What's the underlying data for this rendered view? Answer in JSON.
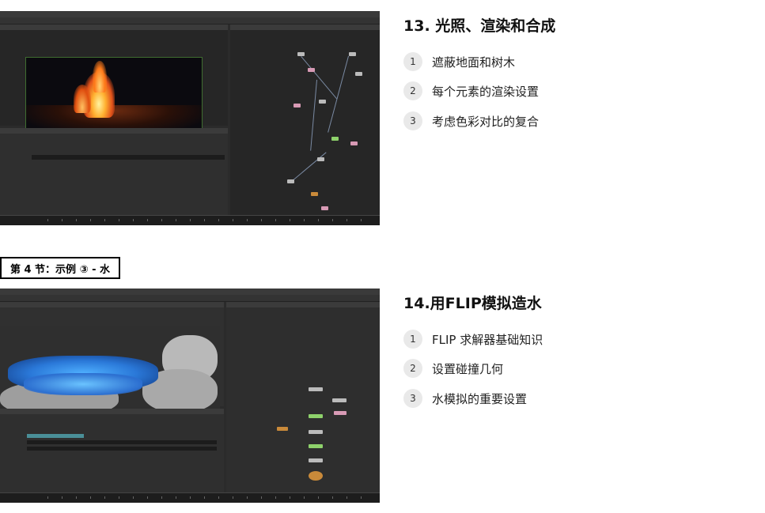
{
  "sections": [
    {
      "title": "13. 光照、渲染和合成",
      "items": [
        {
          "num": "1",
          "label": "遮蔽地面和树木"
        },
        {
          "num": "2",
          "label": "每个元素的渲染设置"
        },
        {
          "num": "3",
          "label": "考虑色彩对比的复合"
        }
      ]
    },
    {
      "title": "14.用FLIP模拟造水",
      "items": [
        {
          "num": "1",
          "label": "FLIP 求解器基础知识"
        },
        {
          "num": "2",
          "label": "设置碰撞几何"
        },
        {
          "num": "3",
          "label": "水模拟的重要设置"
        }
      ]
    }
  ],
  "section_tag": "第 4 节：示例 ③ - 水",
  "colors": {
    "accent_bg": "#e9e9e9",
    "tag_border": "#000000",
    "app_bg": "#2b2b2b"
  }
}
